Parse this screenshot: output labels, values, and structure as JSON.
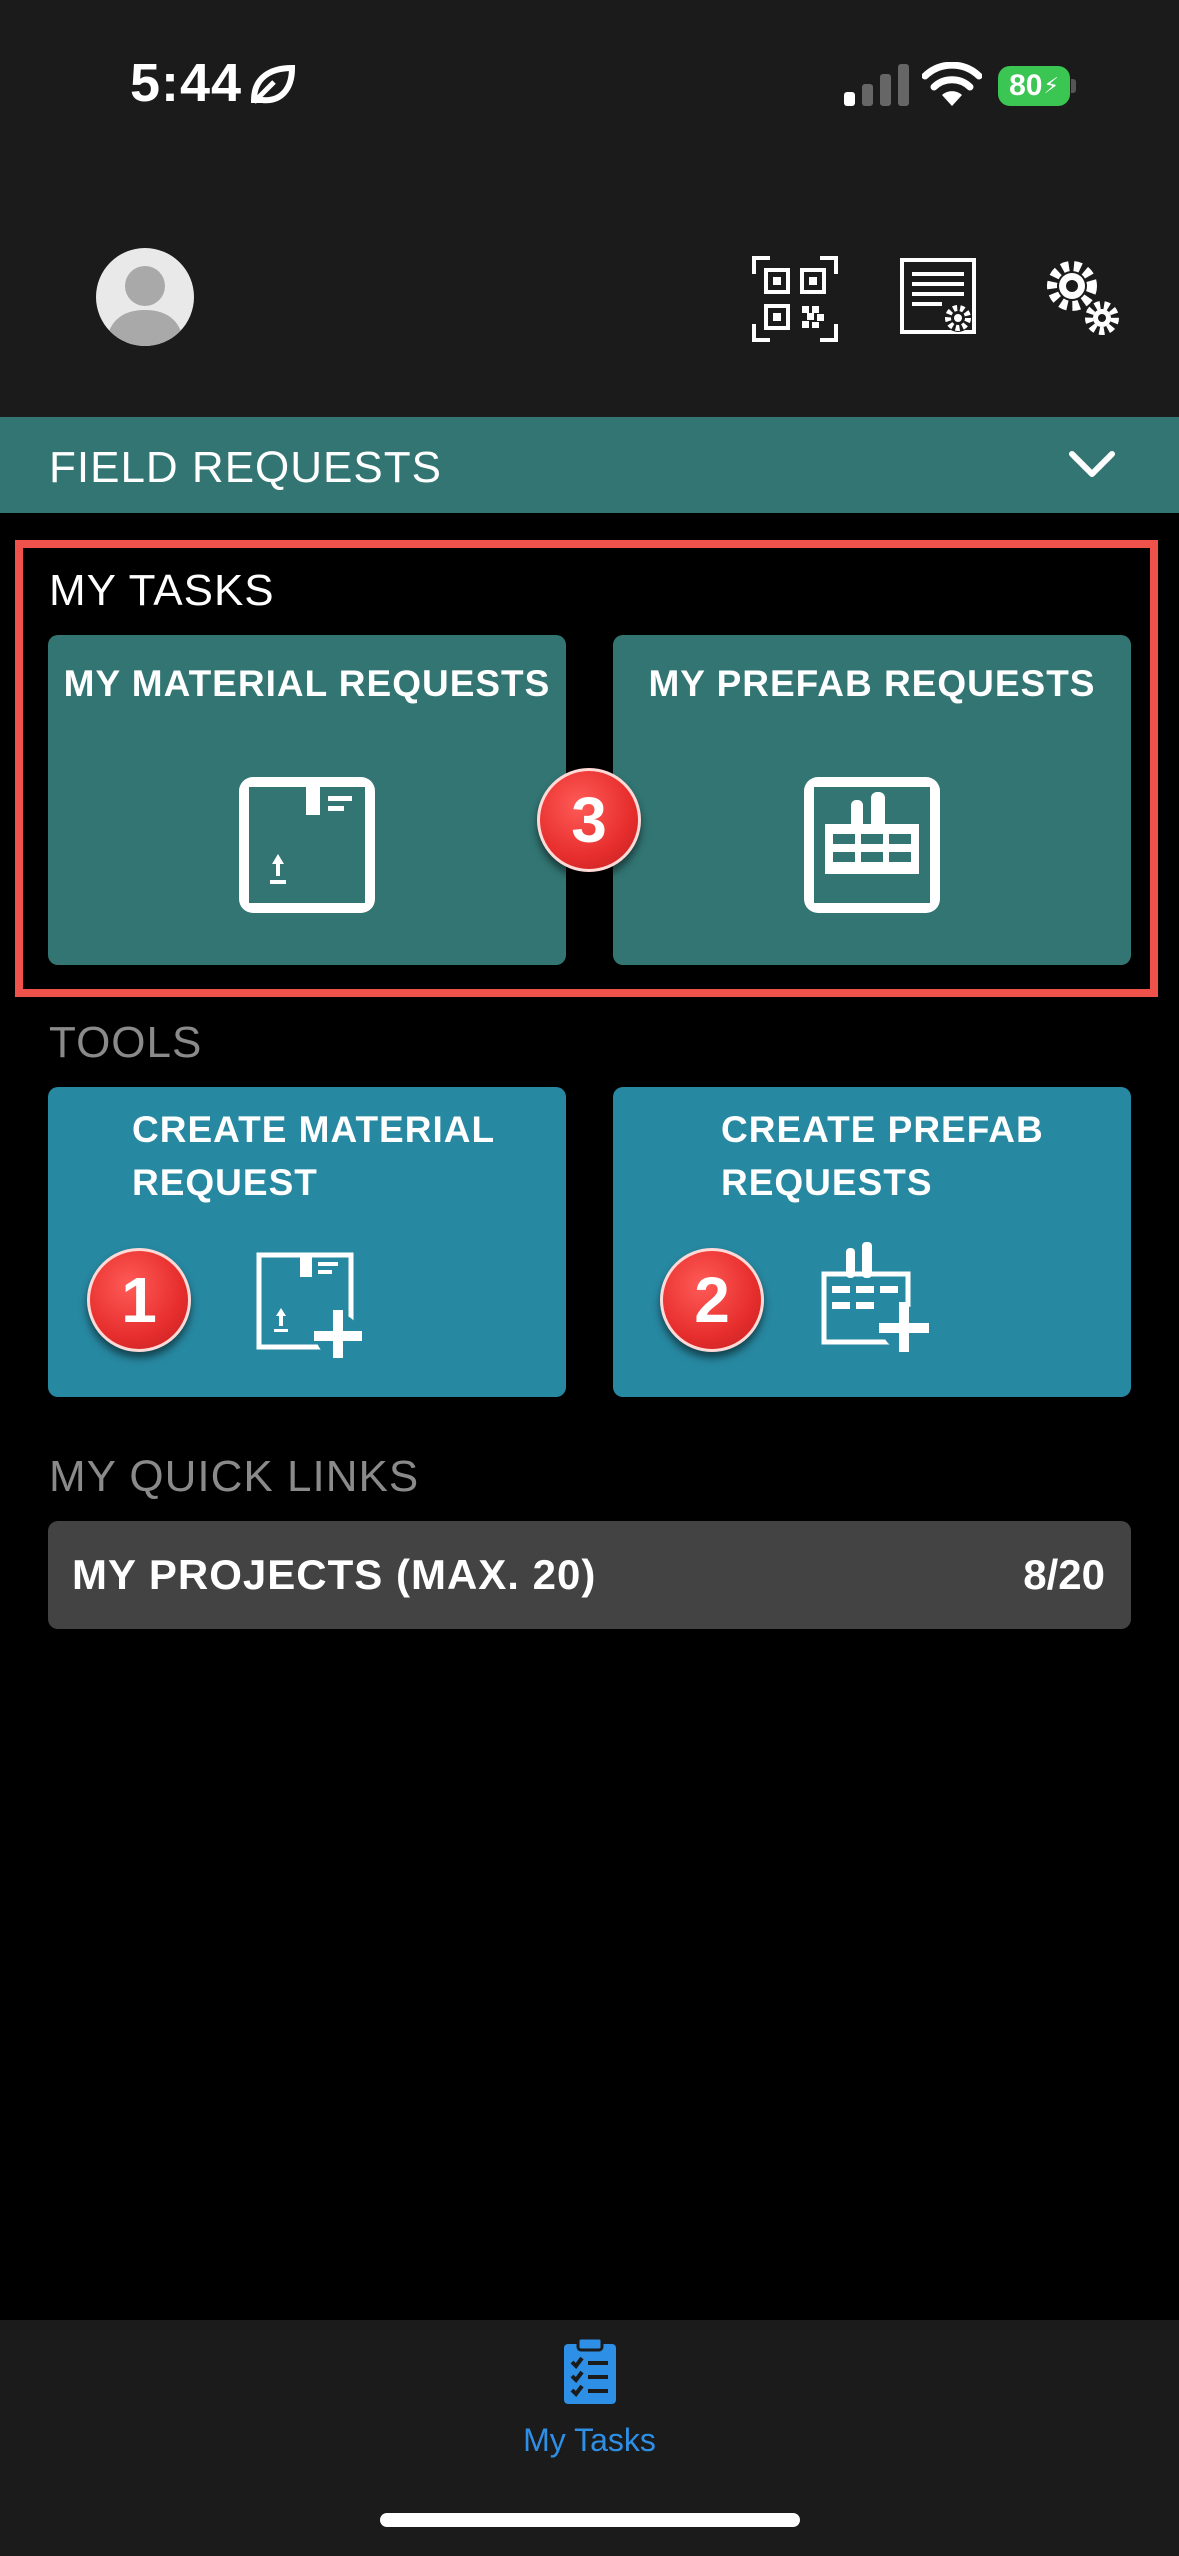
{
  "status_bar": {
    "time": "5:44",
    "battery": "80"
  },
  "header": {
    "icons": [
      "avatar",
      "qr-code-icon",
      "document-settings-icon",
      "gears-icon"
    ]
  },
  "section_bar": {
    "title": "FIELD REQUESTS"
  },
  "my_tasks": {
    "title": "MY TASKS",
    "cards": [
      {
        "label": "MY MATERIAL REQUESTS",
        "icon": "package-icon"
      },
      {
        "label": "MY PREFAB REQUESTS",
        "icon": "factory-icon"
      }
    ]
  },
  "tools": {
    "title": "TOOLS",
    "cards": [
      {
        "label_line1": "CREATE MATERIAL",
        "label_line2": "REQUEST",
        "icon": "package-add-icon"
      },
      {
        "label_line1": "CREATE PREFAB",
        "label_line2": "REQUESTS",
        "icon": "factory-add-icon"
      }
    ]
  },
  "quick_links": {
    "title": "MY QUICK LINKS",
    "items": [
      {
        "label": "MY PROJECTS (MAX. 20)",
        "count": "8/20"
      }
    ]
  },
  "badges": [
    "1",
    "2",
    "3"
  ],
  "tabbar": {
    "tabs": [
      {
        "label": "My Tasks",
        "icon": "checklist-icon"
      }
    ]
  },
  "colors": {
    "accent_teal": "#327573",
    "tool_blue": "#2788a1",
    "highlight_red": "#ef524a",
    "tab_active": "#2e8fe6"
  }
}
